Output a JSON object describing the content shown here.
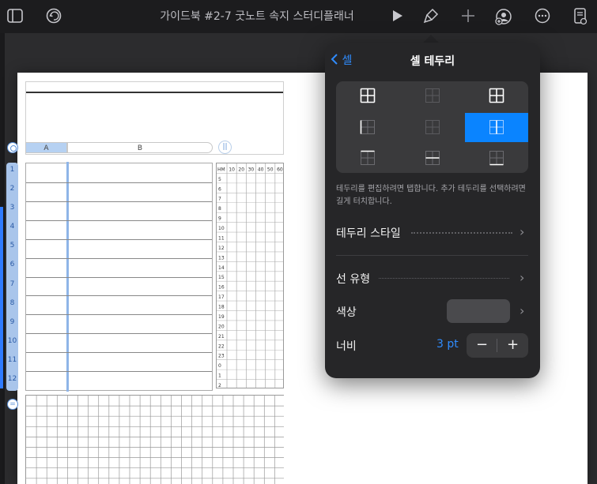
{
  "toolbar": {
    "title": "가이드북 #2-7 굿노트 속지 스터디플래너",
    "icons": [
      "sidebar-icon",
      "undo-icon",
      "play-icon",
      "format-brush-icon",
      "add-icon",
      "collaborate-icon",
      "more-icon",
      "document-options-icon"
    ]
  },
  "sheet": {
    "columns": [
      "A",
      "B"
    ],
    "rows": [
      "1",
      "2",
      "3",
      "4",
      "5",
      "6",
      "7",
      "8",
      "9",
      "10",
      "11",
      "12"
    ],
    "time_header": [
      "HM",
      "10",
      "20",
      "30",
      "40",
      "50",
      "60"
    ],
    "hours": [
      "5",
      "6",
      "7",
      "8",
      "9",
      "10",
      "11",
      "12",
      "13",
      "14",
      "15",
      "16",
      "17",
      "18",
      "19",
      "20",
      "21",
      "22",
      "23",
      "0",
      "1",
      "2"
    ]
  },
  "popover": {
    "back_label": "셀",
    "title": "셀 테두리",
    "selected_cell": 5,
    "hint": "테두리를 편집하려면 탭합니다. 추가 테두리를 선택하려면 길게 터치합니다.",
    "border_style_label": "테두리 스타일",
    "line_type_label": "선 유형",
    "color_label": "색상",
    "width_label": "너비",
    "width_value": "3 pt",
    "minus": "−",
    "plus": "+",
    "accent": "#0a84ff"
  }
}
